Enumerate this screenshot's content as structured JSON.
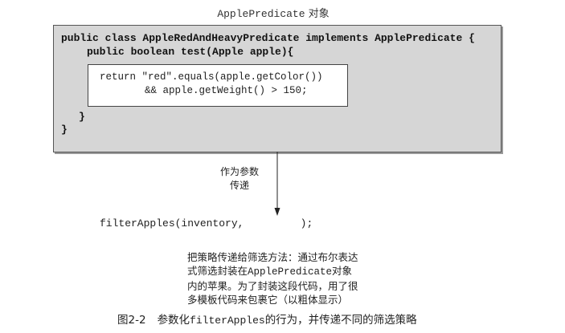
{
  "title": {
    "code": "ApplePredicate",
    "suffix": " 对象"
  },
  "code": {
    "line1": "public class AppleRedAndHeavyPredicate implements ApplePredicate {",
    "line2": "public boolean test(Apple apple){",
    "inner_line1": "return \"red\".equals(apple.getColor())",
    "inner_line2": "&& apple.getWeight() > 150;",
    "close_method": "}",
    "close_class": "}"
  },
  "pass_label": [
    "作为参数",
    "传递"
  ],
  "call": "filterApples(inventory,         );",
  "description": {
    "line1": "把策略传递给筛选方法：通过布尔表达",
    "line2_pre": "式筛选封装在",
    "line2_code": "ApplePredicate",
    "line2_post": "对象",
    "line3": "内的苹果。为了封装这段代码，用了很",
    "line4": "多模板代码来包裹它（以粗体显示）"
  },
  "caption": {
    "number": "图2-2",
    "pre": "参数化",
    "code": "filterApples",
    "post": "的行为，并传递不同的筛选策略"
  }
}
